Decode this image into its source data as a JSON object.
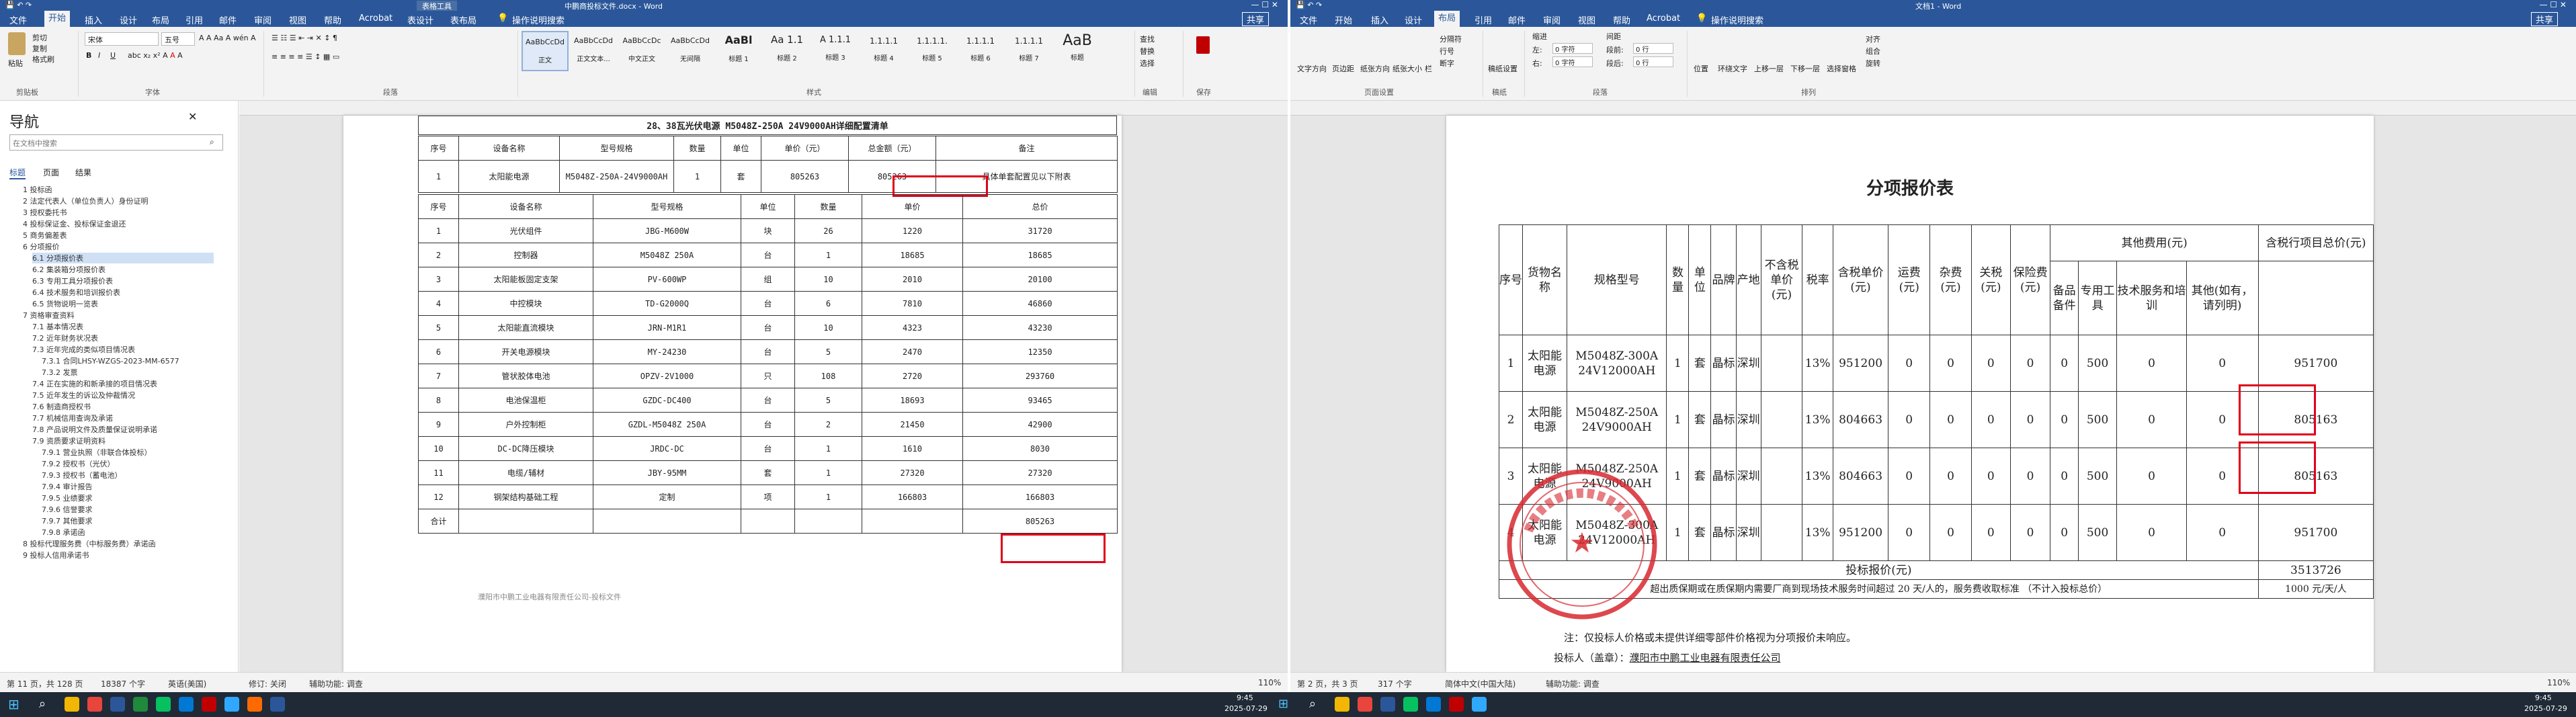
{
  "left_window": {
    "title": "中鹏商投标文件.docx - Word",
    "contextual_tab": "表格工具",
    "tabs": [
      "文件",
      "开始",
      "插入",
      "设计",
      "布局",
      "引用",
      "邮件",
      "审阅",
      "视图",
      "帮助",
      "Acrobat",
      "表设计",
      "表布局"
    ],
    "active_tab": "开始",
    "tell_me": "操作说明搜索",
    "share": "共享",
    "clipboard": {
      "paste": "粘贴",
      "cut": "剪切",
      "copy": "复制",
      "format_painter": "格式刷",
      "group": "剪贴板"
    },
    "font": {
      "family": "宋体",
      "size": "五号",
      "group": "字体"
    },
    "paragraph_group": "段落",
    "styles": [
      {
        "preview": "AaBbCcDd",
        "name": "正文"
      },
      {
        "preview": "AaBbCcDd",
        "name": "正文文本..."
      },
      {
        "preview": "AaBbCcDc",
        "name": "中文正文"
      },
      {
        "preview": "AaBbCcDd",
        "name": "无间隔"
      },
      {
        "preview": "AaBl",
        "name": "标题 1"
      },
      {
        "preview": "Aa 1.1",
        "name": "标题 2"
      },
      {
        "preview": "A 1.1.1",
        "name": "标题 3"
      },
      {
        "preview": "1.1.1.1",
        "name": "标题 4"
      },
      {
        "preview": "1.1.1.1.",
        "name": "标题 5"
      },
      {
        "preview": "1.1.1.1",
        "name": "标题 6"
      },
      {
        "preview": "1.1.1.1",
        "name": "标题 7"
      },
      {
        "preview": "AaB",
        "name": "标题"
      }
    ],
    "styles_group": "样式",
    "editing": {
      "find": "查找",
      "replace": "替换",
      "select": "选择",
      "group": "编辑"
    },
    "save_group": "保存",
    "nav": {
      "title": "导航",
      "search_placeholder": "在文档中搜索",
      "tabs": [
        "标题",
        "页面",
        "结果"
      ],
      "items": [
        "1 投标函",
        "2 法定代表人（单位负责人）身份证明",
        "3 授权委托书",
        "4 投标保证金、投标保证金退还",
        "5 商务偏差表",
        "6 分项报价",
        "6.1 分项报价表",
        "6.2 集装箱分项报价表",
        "6.3 专用工具分项报价表",
        "6.4 技术服务和培训报价表",
        "6.5 货物说明一览表",
        "7 资格审查资料",
        "7.1 基本情况表",
        "7.2 近年财务状况表",
        "7.3 近年完成的类似项目情况表",
        "7.3.1 合同LHSY-WZGS-2023-MM-6577",
        "7.3.2 发票",
        "7.4 正在实施的和新承接的项目情况表",
        "7.5 近年发生的诉讼及仲裁情况",
        "7.6 制造商授权书",
        "7.7 机械信用查询及承诺",
        "7.8 产品说明文件及质量保证说明承诺",
        "7.9 资质要求证明资料",
        "7.9.1 营业执照（非联合体投标）",
        "7.9.2 授权书（光伏）",
        "7.9.3 授权书（蓄电池）",
        "7.9.4 审计报告",
        "7.9.5 业绩要求",
        "7.9.6 信誉要求",
        "7.9.7 其他要求",
        "7.9.8 承诺函",
        "8 投标代理服务费（中标服务费）承诺函",
        "9 投标人信用承诺书"
      ]
    },
    "doc_title": "28、38瓦光伏电源 M5048Z-250A 24V9000AH详细配置清单",
    "table_top_headers": [
      "序号",
      "设备名称",
      "型号规格",
      "数量",
      "单位",
      "单价（元）",
      "总金额（元）",
      "备注"
    ],
    "table_top_row": [
      "1",
      "太阳能电源",
      "M5048Z-250A-24V9000AH",
      "1",
      "套",
      "805263",
      "805263",
      "具体单套配置见以下附表"
    ],
    "table_headers": [
      "序号",
      "设备名称",
      "型号规格",
      "单位",
      "数量",
      "单价",
      "总价"
    ],
    "table_rows": [
      [
        "1",
        "光伏组件",
        "JBG-M600W",
        "块",
        "26",
        "1220",
        "31720"
      ],
      [
        "2",
        "控制器",
        "M5048Z 250A",
        "台",
        "1",
        "18685",
        "18685"
      ],
      [
        "3",
        "太阳能板固定支架",
        "PV-600WP",
        "组",
        "10",
        "2010",
        "20100"
      ],
      [
        "4",
        "中控模块",
        "TD-G2000Q",
        "台",
        "6",
        "7810",
        "46860"
      ],
      [
        "5",
        "太阳能直流模块",
        "JRN-M1R1",
        "台",
        "10",
        "4323",
        "43230"
      ],
      [
        "6",
        "开关电源模块",
        "MY-24230",
        "台",
        "5",
        "2470",
        "12350"
      ],
      [
        "7",
        "管状胶体电池",
        "OPZV-2V1000",
        "只",
        "108",
        "2720",
        "293760"
      ],
      [
        "8",
        "电池保温柜",
        "GZDC-DC400",
        "台",
        "5",
        "18693",
        "93465"
      ],
      [
        "9",
        "户外控制柜",
        "GZDL-M5048Z 250A",
        "台",
        "2",
        "21450",
        "42900"
      ],
      [
        "10",
        "DC-DC降压模块",
        "JRDC-DC",
        "台",
        "1",
        "1610",
        "8030"
      ],
      [
        "11",
        "电缆/辅材",
        "JBY-95MM",
        "套",
        "1",
        "27320",
        "27320"
      ],
      [
        "12",
        "钢架结构基础工程",
        "定制",
        "项",
        "1",
        "166803",
        "166803"
      ]
    ],
    "total_label": "合计",
    "total_value": "805263",
    "footer_text": "濮阳市中鹏工业电器有限责任公司-投标文件",
    "status": {
      "page": "第 11 页，共 128 页",
      "words": "18387 个字",
      "lang": "英语(美国)",
      "track": "修订: 关闭",
      "access": "辅助功能: 调查",
      "zoom": "110%"
    }
  },
  "right_window": {
    "title": "文档1 - Word",
    "tabs": [
      "文件",
      "开始",
      "插入",
      "设计",
      "布局",
      "引用",
      "邮件",
      "审阅",
      "视图",
      "帮助",
      "Acrobat"
    ],
    "active_tab": "布局",
    "tell_me": "操作说明搜索",
    "share": "共享",
    "ribbon": {
      "text_direction": "文字方向",
      "margins": "页边距",
      "orientation": "纸张方向",
      "size": "纸张大小",
      "columns": "栏",
      "breaks": "分隔符",
      "line_numbers": "行号",
      "hyphenation": "断字",
      "page_setup": "页面设置",
      "indent": "缩进",
      "spacing": "间距",
      "left": "左:",
      "right": "右:",
      "before": "段前:",
      "after": "段后:",
      "indent_left_val": "0 字符",
      "indent_right_val": "0 字符",
      "before_val": "0 行",
      "after_val": "0 行",
      "paragraph": "段落",
      "position": "位置",
      "wrap": "环绕文字",
      "forward": "上移一层",
      "backward": "下移一层",
      "selection_pane": "选择窗格",
      "align": "对齐",
      "group": "组合",
      "rotate": "旋转",
      "arrange": "排列",
      "manuscript": "稿纸设置",
      "manuscript_group": "稿纸"
    },
    "doc_title": "分项报价表",
    "other_fees": "其他费用(元)",
    "total_head": "含税行项目总价(元)",
    "headers": [
      "序号",
      "货物名称",
      "规格型号",
      "数量",
      "单位",
      "品牌",
      "产地",
      "不含税单价(元)",
      "税率",
      "含税单价(元)",
      "运费(元)",
      "杂费(元)",
      "关税(元)",
      "保险费(元)",
      "备品备件",
      "专用工具",
      "技术服务和培训",
      "其他(如有，请列明)"
    ],
    "rows": [
      [
        "1",
        "太阳能电源",
        "M5048Z-300A 24V12000AH",
        "1",
        "套",
        "晶标",
        "深圳",
        "",
        "13%",
        "951200",
        "0",
        "0",
        "0",
        "0",
        "0",
        "500",
        "0",
        "0",
        "951700"
      ],
      [
        "2",
        "太阳能电源",
        "M5048Z-250A 24V9000AH",
        "1",
        "套",
        "晶标",
        "深圳",
        "",
        "13%",
        "804663",
        "0",
        "0",
        "0",
        "0",
        "0",
        "500",
        "0",
        "0",
        "805163"
      ],
      [
        "3",
        "太阳能电源",
        "M5048Z-250A 24V9000AH",
        "1",
        "套",
        "晶标",
        "深圳",
        "",
        "13%",
        "804663",
        "0",
        "0",
        "0",
        "0",
        "0",
        "500",
        "0",
        "0",
        "805163"
      ],
      [
        "4",
        "太阳能电源",
        "M5048Z-300A 24V12000AH",
        "1",
        "套",
        "晶标",
        "深圳",
        "",
        "13%",
        "951200",
        "0",
        "0",
        "0",
        "0",
        "0",
        "500",
        "0",
        "0",
        "951700"
      ]
    ],
    "bid_total_label": "投标报价(元)",
    "bid_total_value": "3513726",
    "service_note": "超出质保期或在质保期内需要厂商到现场技术服务时间超过 20 天/人的，服务费收取标准 （不计入投标总价）",
    "service_value": "1000 元/天/人",
    "note": "注：仅投标人价格或未提供详细零部件价格视为分项报价未响应。",
    "bidder_label": "投标人（盖章）：",
    "bidder_name": "濮阳市中鹏工业电器有限责任公司",
    "status": {
      "page": "第 2 页，共 3 页",
      "words": "317 个字",
      "lang": "简体中文(中国大陆)",
      "access": "辅助功能: 调查",
      "zoom": "110%"
    }
  },
  "taskbar": {
    "time": "9:45",
    "date": "2025-07-29"
  },
  "colors": {
    "word_blue": "#2b579a",
    "highlight": "#e0001a",
    "stamp": "#d7282f"
  }
}
